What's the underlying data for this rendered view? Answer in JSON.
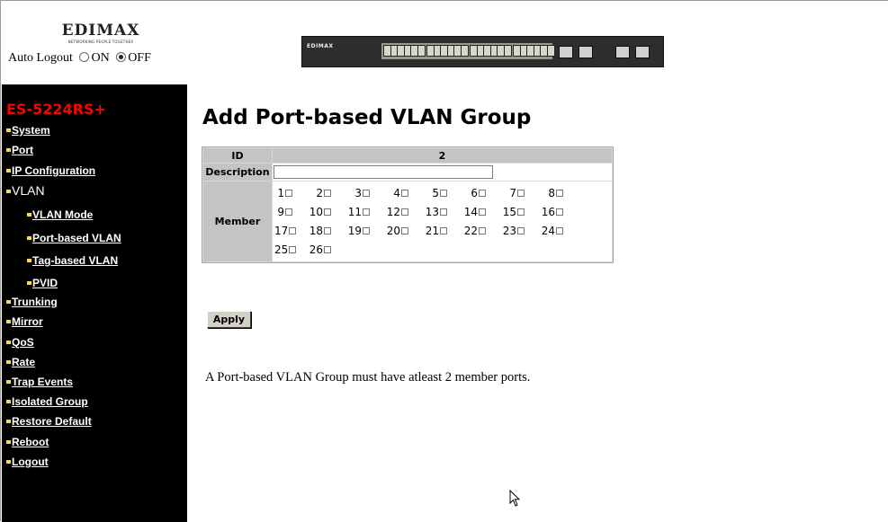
{
  "header": {
    "logo_text": "EDIMAX",
    "logo_tagline": "NETWORKING PEOPLE TOGETHER",
    "auto_logout_label": "Auto Logout",
    "on_label": "ON",
    "off_label": "OFF",
    "auto_logout_value": "OFF",
    "switch_brand": "EDIMAX"
  },
  "sidebar": {
    "model": "ES-5224RS+",
    "items": [
      {
        "label": "System"
      },
      {
        "label": "Port"
      },
      {
        "label": "IP Configuration"
      },
      {
        "label": "VLAN"
      },
      {
        "label": "VLAN Mode"
      },
      {
        "label": "Port-based VLAN"
      },
      {
        "label": "Tag-based VLAN"
      },
      {
        "label": "PVID"
      },
      {
        "label": "Trunking"
      },
      {
        "label": "Mirror"
      },
      {
        "label": "QoS"
      },
      {
        "label": "Rate"
      },
      {
        "label": "Trap Events"
      },
      {
        "label": "Isolated Group"
      },
      {
        "label": "Restore Default"
      },
      {
        "label": "Reboot"
      },
      {
        "label": "Logout"
      }
    ]
  },
  "main": {
    "title": "Add Port-based VLAN Group",
    "table": {
      "id_label": "ID",
      "id_value": "2",
      "description_label": "Description",
      "description_value": "",
      "member_label": "Member"
    },
    "ports": [
      "1",
      "2",
      "3",
      "4",
      "5",
      "6",
      "7",
      "8",
      "9",
      "10",
      "11",
      "12",
      "13",
      "14",
      "15",
      "16",
      "17",
      "18",
      "19",
      "20",
      "21",
      "22",
      "23",
      "24",
      "25",
      "26"
    ],
    "apply_label": "Apply",
    "note": "A Port-based VLAN Group must have atleast 2 member ports."
  },
  "colors": {
    "model_text": "#ff0000",
    "sidebar_bg": "#000000",
    "bullet": "#ffd84a",
    "table_header_bg": "#c4c4c4"
  }
}
